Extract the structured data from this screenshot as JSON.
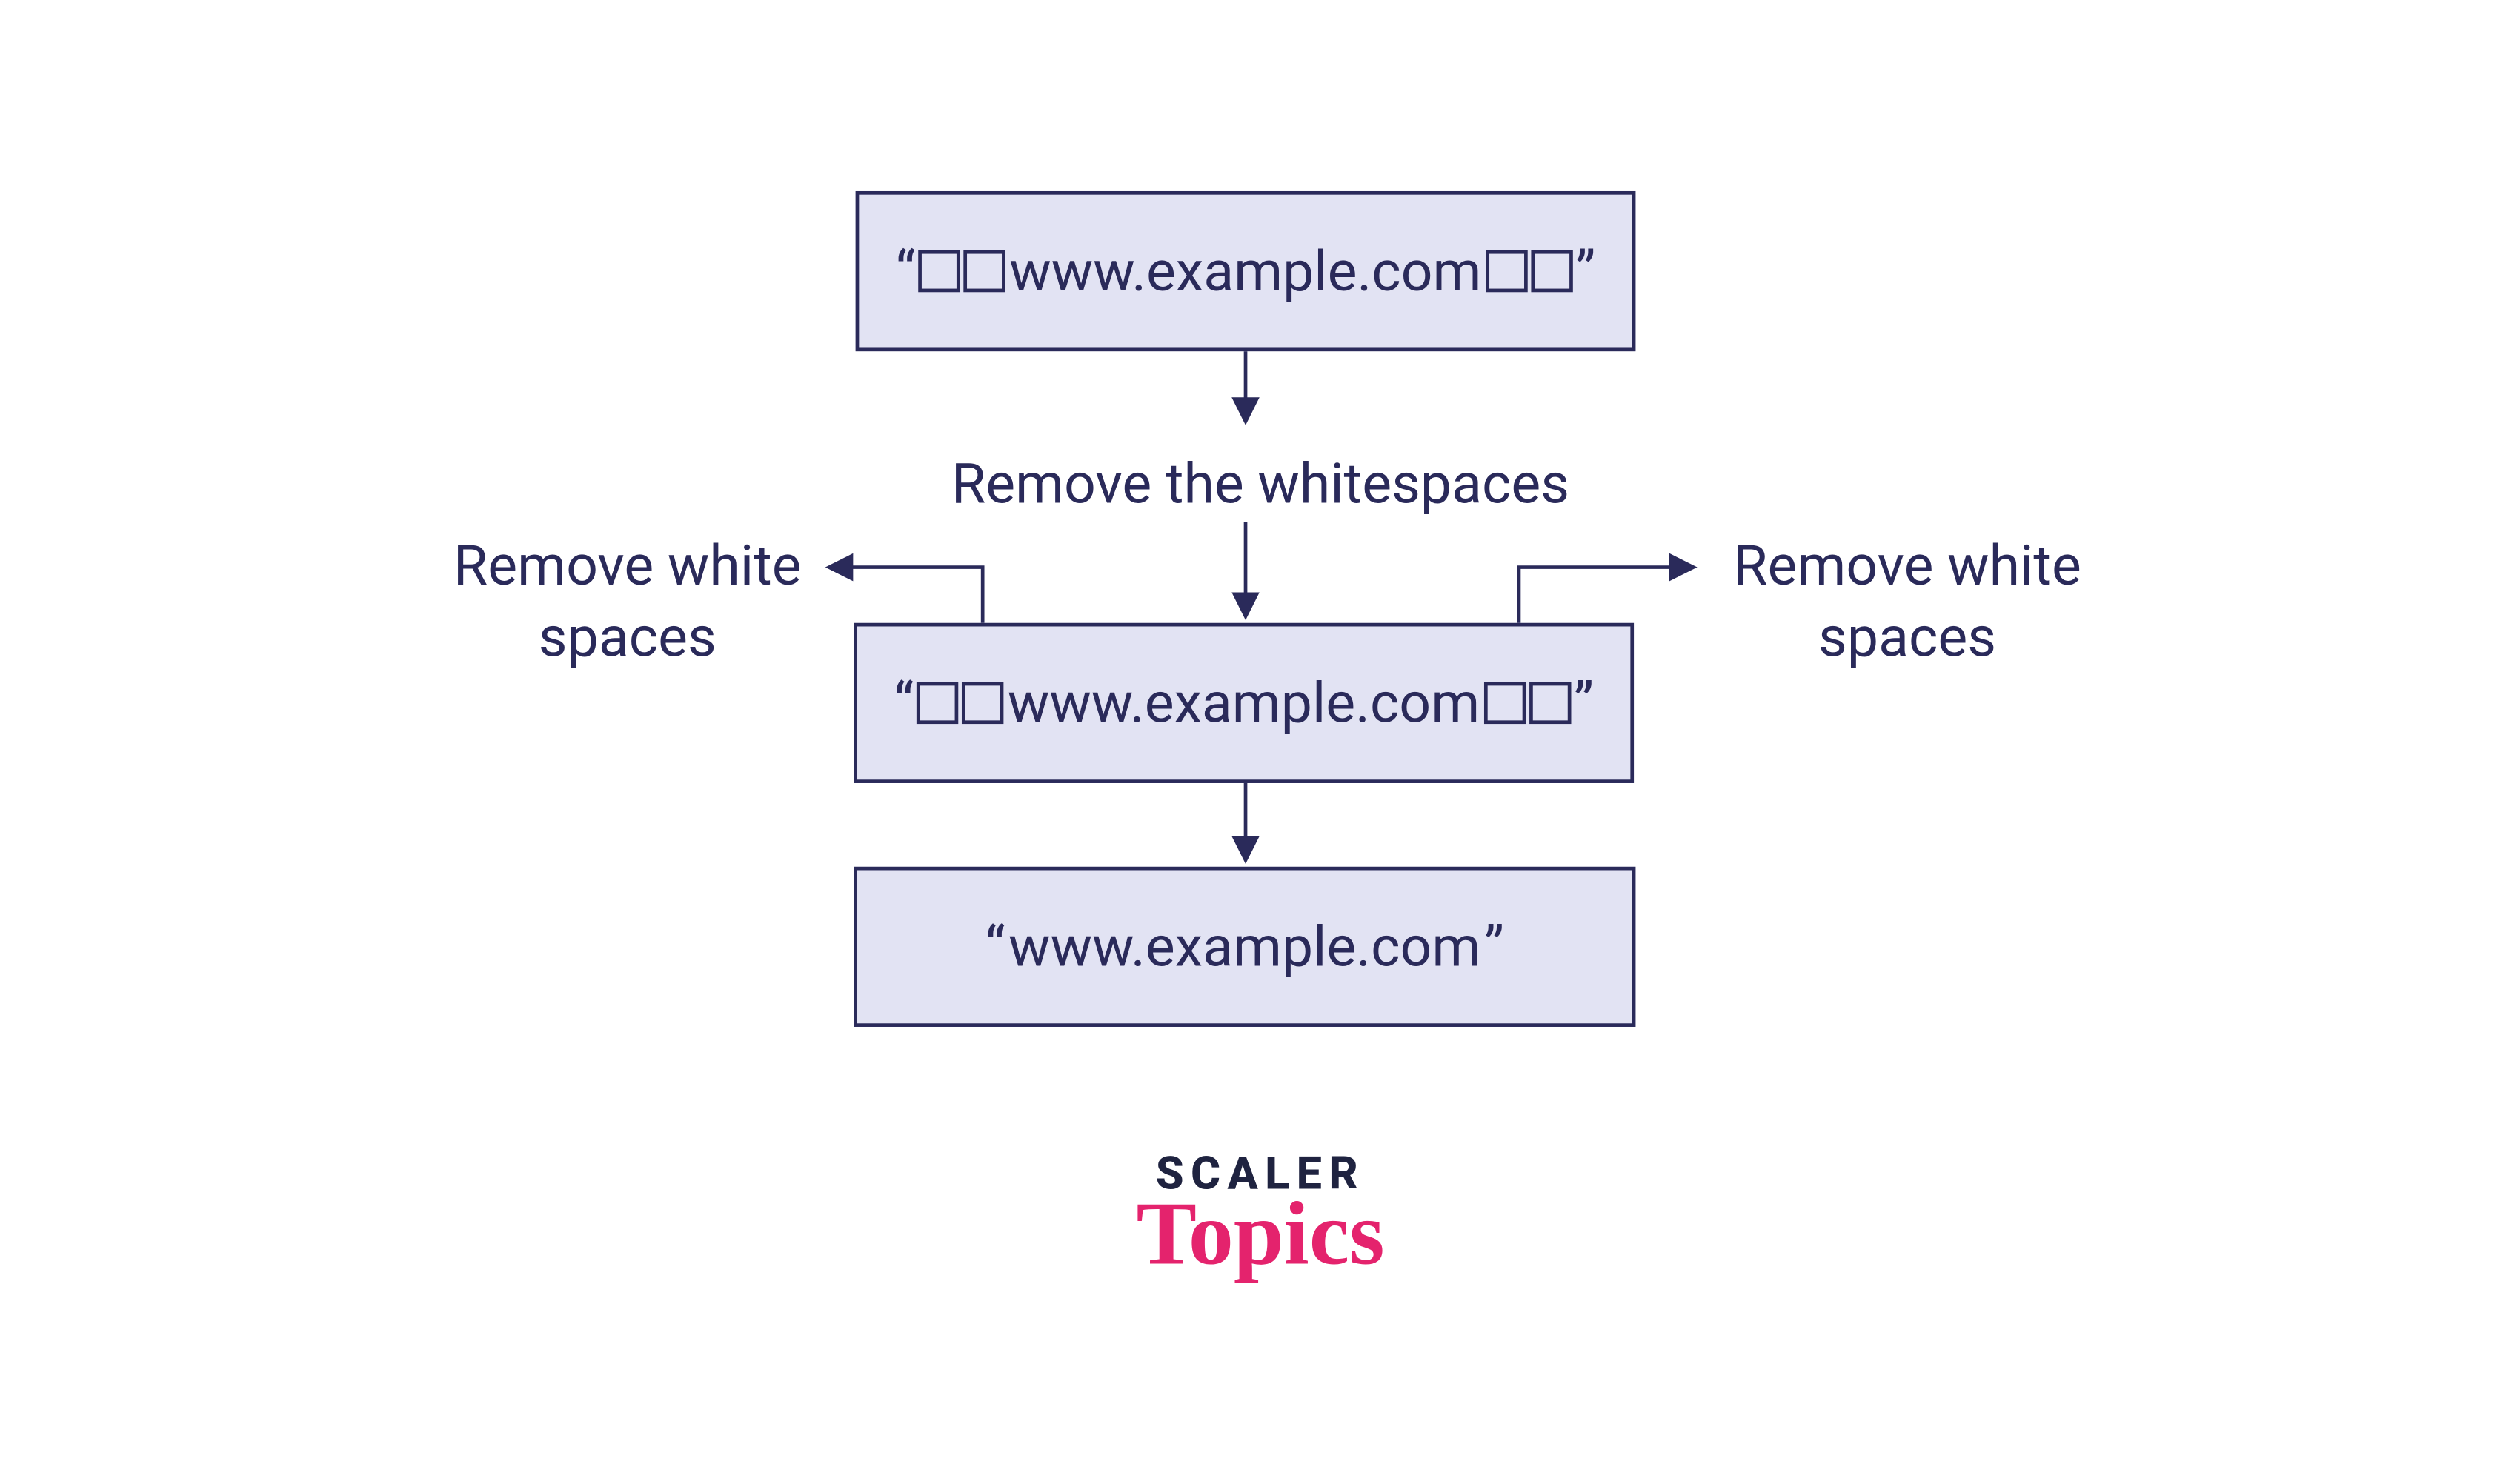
{
  "colors": {
    "box_fill": "#E2E3F3",
    "box_border": "#2A2A5A",
    "highlight": "#FBCB77",
    "text": "#2A2A5A",
    "logo_dark": "#1F2340",
    "logo_pink": "#E4236D"
  },
  "diagram": {
    "box1": {
      "quote_open": "“",
      "quote_close": "”",
      "leading_spaces": 2,
      "content": "www.example.com",
      "trailing_spaces": 2
    },
    "step_label": "Remove the whitespaces",
    "side_left_line1": "Remove white",
    "side_left_line2": "spaces",
    "side_right_line1": "Remove white",
    "side_right_line2": "spaces",
    "box2": {
      "quote_open": "“",
      "quote_close": "”",
      "leading_spaces": 2,
      "content": "www.example.com",
      "trailing_spaces": 2
    },
    "box3": {
      "quote_open": "“",
      "quote_close": "”",
      "content": "www.example.com"
    }
  },
  "logo": {
    "line1": "SCALER",
    "line2": "Topics"
  }
}
